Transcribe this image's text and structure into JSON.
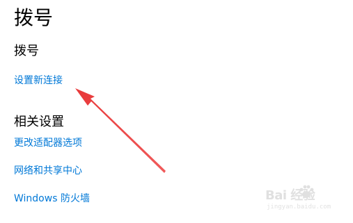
{
  "accent_color": "#0078d7",
  "annotation_arrow_color": "#e8393a",
  "page": {
    "title": "拨号"
  },
  "dial_section": {
    "heading": "拨号",
    "setup_link": "设置新连接"
  },
  "related_settings": {
    "heading": "相关设置",
    "links": [
      "更改适配器选项",
      "网络和共享中心",
      "Windows 防火墙"
    ]
  },
  "watermark": {
    "logo_text": "Bai  经验",
    "url_text": "jingyan.baidu.com"
  }
}
